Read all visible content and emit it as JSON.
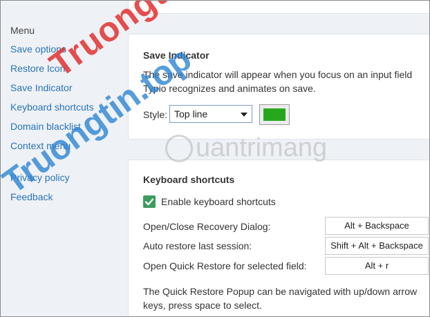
{
  "sidebar": {
    "title": "Menu",
    "items": [
      {
        "label": "Save options"
      },
      {
        "label": "Restore Icon"
      },
      {
        "label": "Save Indicator"
      },
      {
        "label": "Keyboard shortcuts"
      },
      {
        "label": "Domain blacklist"
      },
      {
        "label": "Context menu"
      }
    ],
    "secondary": [
      {
        "label": "Privacy policy"
      },
      {
        "label": "Feedback"
      }
    ]
  },
  "save_indicator": {
    "title": "Save Indicator",
    "description_lines": [
      "The save indicator will appear when you focus on an input field",
      "Typio recognizes and animates on save."
    ],
    "style_label": "Style:",
    "style_value": "Top line",
    "color": "#27a81c"
  },
  "keyboard_shortcuts": {
    "title": "Keyboard shortcuts",
    "enable_label": "Enable keyboard shortcuts",
    "enabled": true,
    "checkbox_color": "#3b9c5e",
    "rows": [
      {
        "label": "Open/Close Recovery Dialog:",
        "keys": "Alt + Backspace"
      },
      {
        "label": "Auto restore last session:",
        "keys": "Shift + Alt + Backspace"
      },
      {
        "label": "Open Quick Restore for selected field:",
        "keys": "Alt + r"
      }
    ],
    "note_lines": [
      "The Quick Restore Popup can be navigated with up/down arrow",
      "keys, press space to select."
    ]
  },
  "watermarks": {
    "red": "Truongtin.top",
    "grey": "uantrimang"
  }
}
